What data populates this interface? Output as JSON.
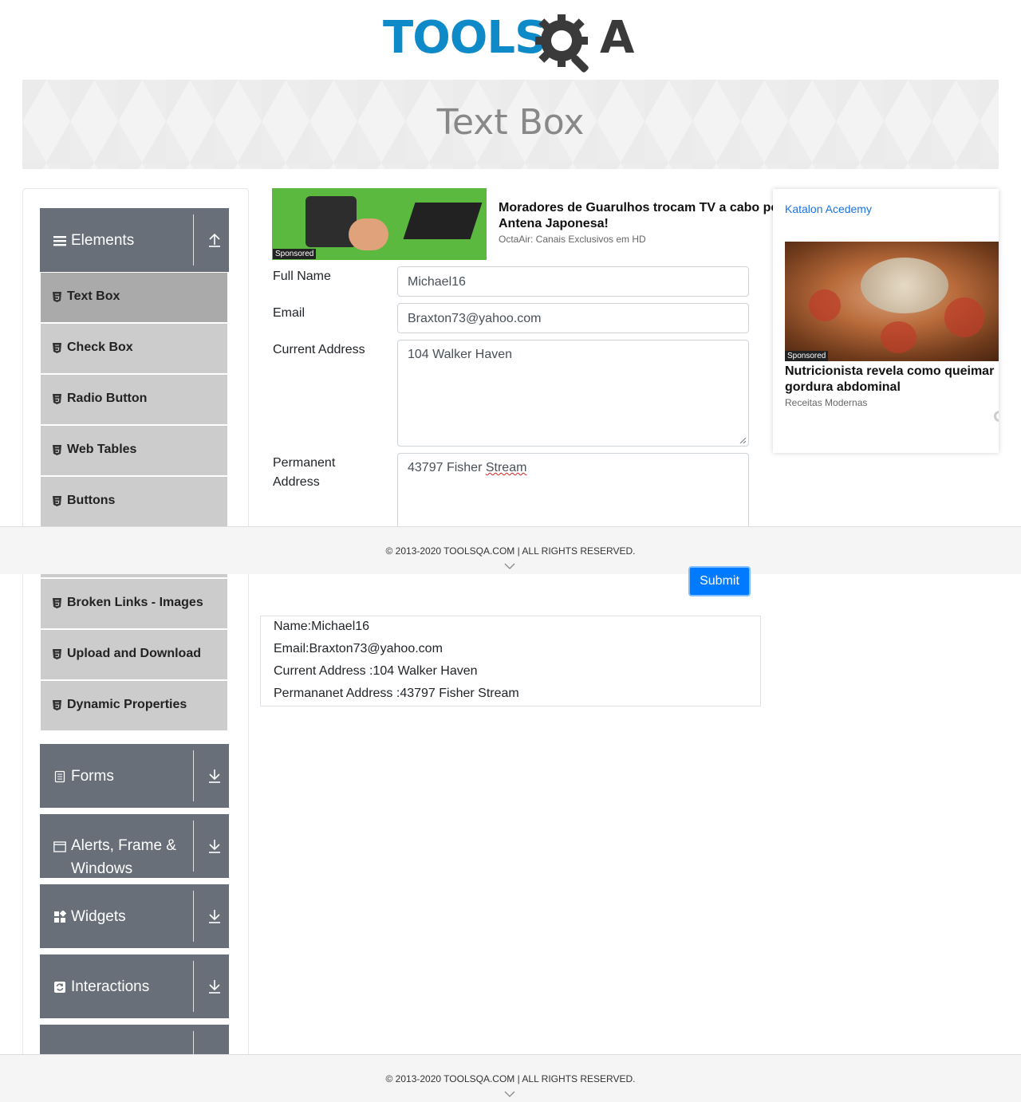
{
  "header": {
    "logo_text_left": "TOOLS",
    "logo_text_right": "A",
    "logo_icon": "gear-magnifier-icon"
  },
  "banner": {
    "title": "Text Box"
  },
  "sidebar": {
    "groups": [
      {
        "label": "Elements",
        "icon": "hamburger-icon",
        "arrow": "collapse-arrow-icon"
      },
      {
        "label": "Forms",
        "icon": "document-icon",
        "arrow": "expand-arrow-icon"
      },
      {
        "label": "Alerts, Frame & Windows",
        "label_line1": "Alerts, Frame &",
        "label_line2": "Windows",
        "icon": "window-icon",
        "arrow": "expand-arrow-icon"
      },
      {
        "label": "Widgets",
        "icon": "widgets-icon",
        "arrow": "expand-arrow-icon"
      },
      {
        "label": "Interactions",
        "icon": "interactions-icon",
        "arrow": "expand-arrow-icon"
      }
    ],
    "items": [
      {
        "label": "Text Box",
        "active": true
      },
      {
        "label": "Check Box"
      },
      {
        "label": "Radio Button"
      },
      {
        "label": "Web Tables"
      },
      {
        "label": "Buttons"
      },
      {
        "label": "Broken Links - Images"
      },
      {
        "label": "Upload and Download"
      },
      {
        "label": "Dynamic Properties"
      }
    ]
  },
  "top_ad": {
    "sponsored": "Sponsored",
    "title_line1": "Moradores de Guarulhos trocam TV a cabo pela",
    "title_line2": "Antena Japonesa!",
    "source": "OctaAir: Canais Exclusivos em HD"
  },
  "form": {
    "full_name_label": "Full Name",
    "full_name_value": "Michael16",
    "email_label": "Email",
    "email_value": "Braxton73@yahoo.com",
    "current_address_label": "Current Address",
    "current_address_value": "104 Walker Haven",
    "permanent_address_label_line1": "Permanent",
    "permanent_address_label_line2": "Address",
    "permanent_address_value_pre": "43797 Fisher ",
    "permanent_address_value_misspelled": "Stream",
    "submit_label": "Submit"
  },
  "side_ad": {
    "broken_image_alt": "Katalon Acedemy",
    "sponsored": "Sponsored",
    "title": "Nutricionista revela como queimar gordura abdominal",
    "source": "Receitas Modernas"
  },
  "output": {
    "name": "Name:Michael16",
    "email": "Email:Braxton73@yahoo.com",
    "current_address": "Current Address :104 Walker Haven",
    "permanent_address": "Permananet Address :43797 Fisher Stream"
  },
  "footer": {
    "copyright": "© 2013-2020 TOOLSQA.COM | ALL RIGHTS RESERVED."
  },
  "colors": {
    "brand_blue": "#0f8ac9",
    "sidebar_group": "#696f78",
    "sidebar_item": "#cccccc",
    "sidebar_item_active": "#aaaaaa",
    "submit": "#007bff"
  }
}
